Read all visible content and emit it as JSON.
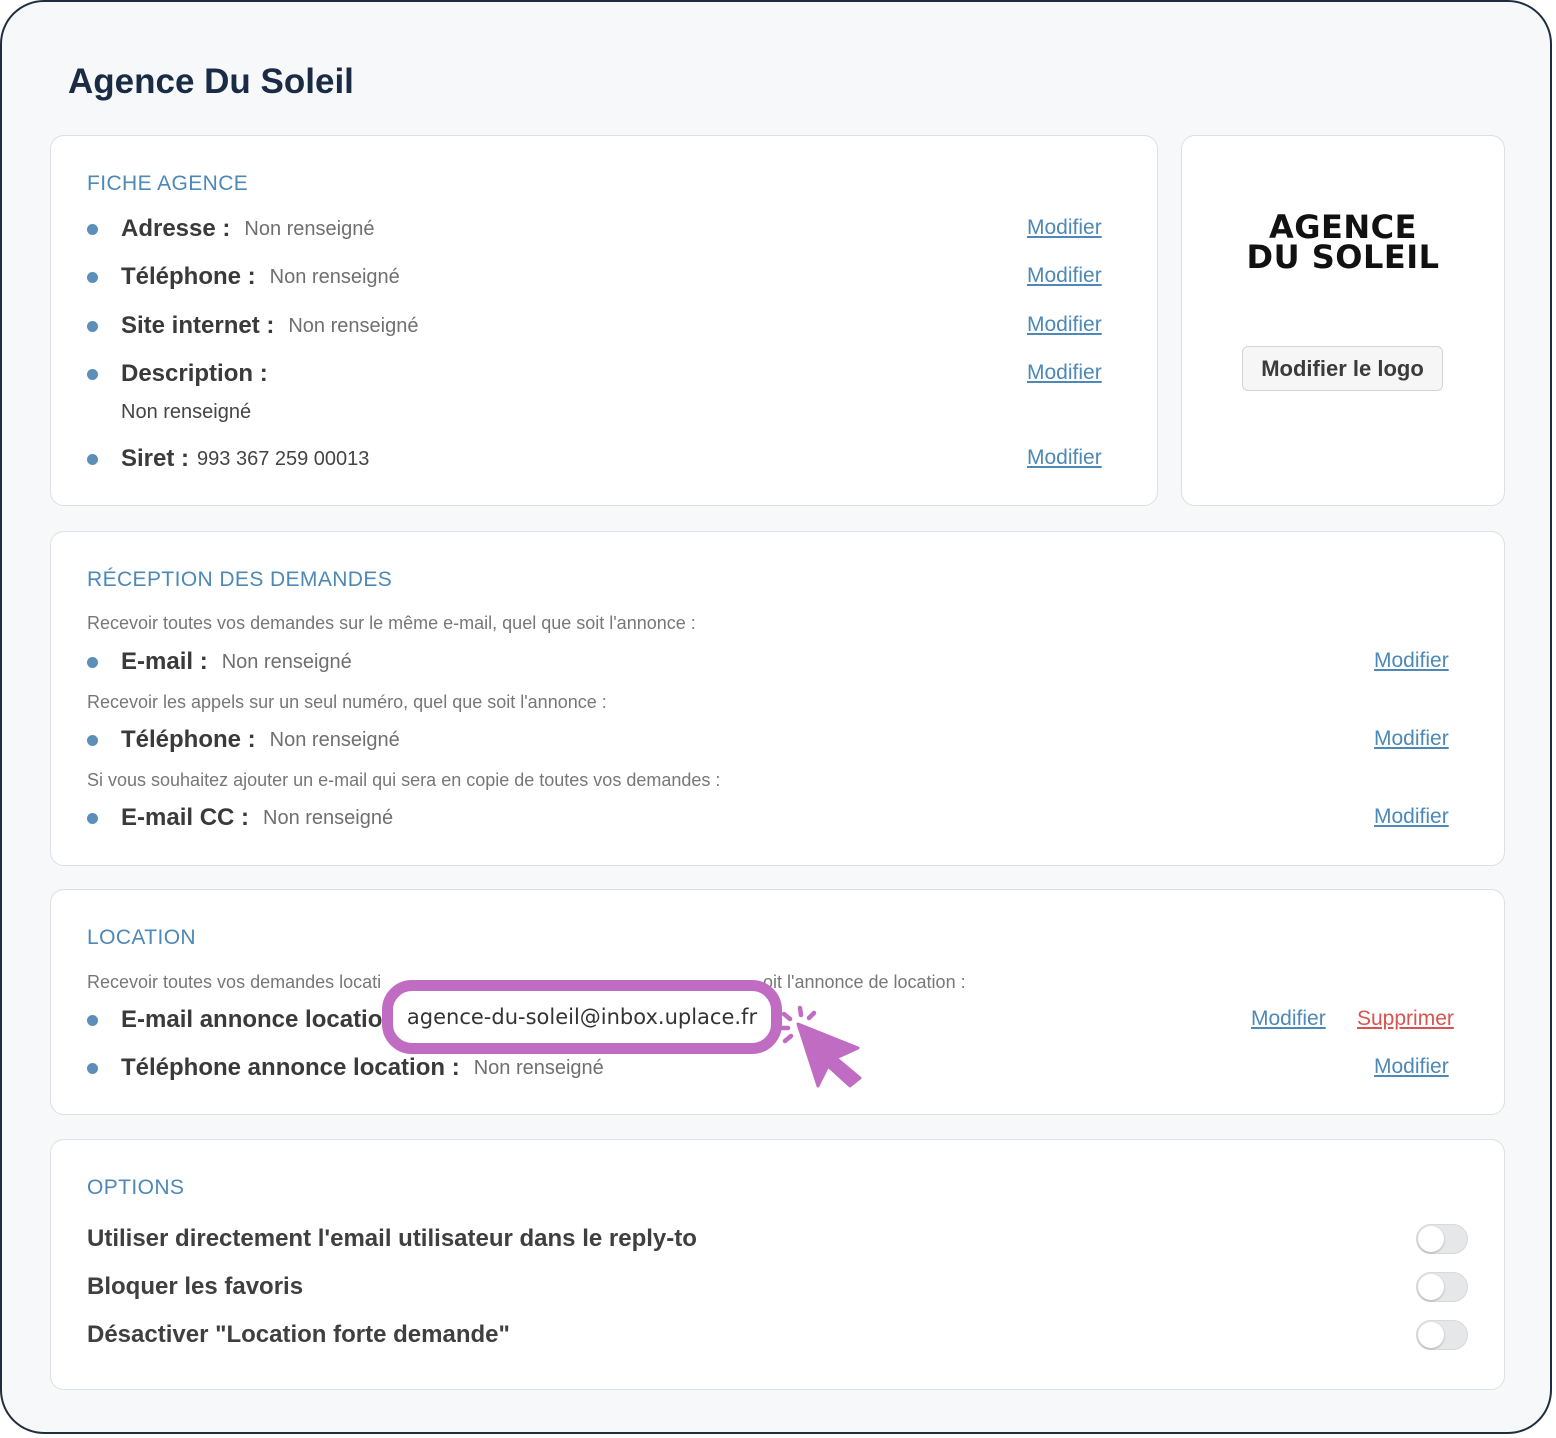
{
  "page": {
    "title": "Agence Du Soleil"
  },
  "fiche": {
    "title": "FICHE AGENCE",
    "rows": [
      {
        "label": "Adresse :",
        "value": "Non renseigné",
        "action": "Modifier"
      },
      {
        "label": "Téléphone :",
        "value": "Non renseigné",
        "action": "Modifier"
      },
      {
        "label": "Site internet :",
        "value": "Non renseigné",
        "action": "Modifier"
      },
      {
        "label": "Description :",
        "value": "Non renseigné",
        "action": "Modifier"
      },
      {
        "label": "Siret :",
        "value": "993 367 259 00013",
        "action": "Modifier"
      }
    ]
  },
  "logo": {
    "line1": "AGENCE",
    "line2": "DU SOLEIL",
    "button": "Modifier le logo"
  },
  "reception": {
    "title": "RÉCEPTION DES DEMANDES",
    "hint_email": "Recevoir toutes vos demandes sur le même e-mail, quel que soit l'annonce :",
    "email": {
      "label": "E-mail :",
      "value": "Non renseigné",
      "action": "Modifier"
    },
    "hint_phone": "Recevoir les appels sur un seul numéro, quel que soit l'annonce :",
    "phone": {
      "label": "Téléphone :",
      "value": "Non renseigné",
      "action": "Modifier"
    },
    "hint_cc": "Si vous souhaitez ajouter un e-mail qui sera en copie de toutes vos demandes :",
    "cc": {
      "label": "E-mail CC :",
      "value": "Non renseigné",
      "action": "Modifier"
    }
  },
  "location": {
    "title": "LOCATION",
    "hint_left": "Recevoir toutes vos demandes locati",
    "hint_right": "oit l'annonce de location :",
    "email": {
      "label": "E-mail annonce location",
      "value": "agence-du-soleil@inbox.uplace.fr",
      "action": "Modifier",
      "delete": "Supprimer"
    },
    "phone": {
      "label": "Téléphone annonce location :",
      "value": "Non renseigné",
      "action": "Modifier"
    }
  },
  "options": {
    "title": "OPTIONS",
    "items": [
      {
        "label": "Utiliser directement l'email utilisateur dans le reply-to",
        "enabled": false
      },
      {
        "label": "Bloquer les favoris",
        "enabled": false
      },
      {
        "label": "Désactiver \"Location forte demande\"",
        "enabled": false
      }
    ]
  },
  "colors": {
    "accent": "#4d88b7",
    "danger": "#d9534f",
    "highlight": "#c06cc2",
    "title": "#1a2b45"
  }
}
